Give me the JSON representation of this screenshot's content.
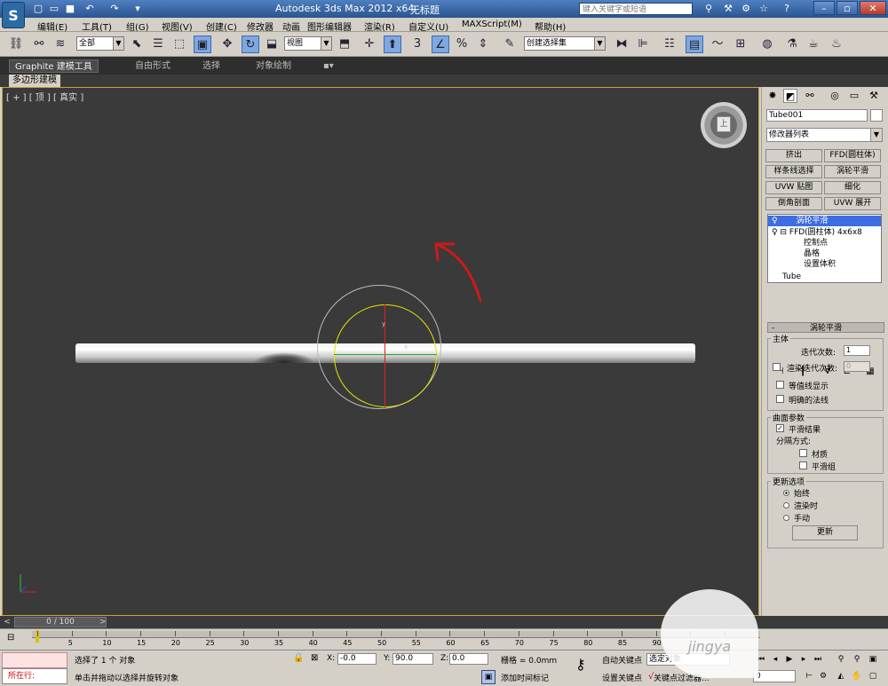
{
  "title_bar": {
    "title": "Autodesk 3ds Max  2012 x64",
    "file_name": "无标题",
    "search_placeholder": "键入关键字或短语",
    "app_icon": "3ds-max-logo",
    "quick_access_icons": [
      "new-icon",
      "open-icon",
      "save-icon",
      "undo-icon",
      "redo-icon"
    ],
    "help_icon": "help-icon"
  },
  "menu": [
    "编辑(E)",
    "工具(T)",
    "组(G)",
    "视图(V)",
    "创建(C)",
    "修改器",
    "动画",
    "图形编辑器",
    "渲染(R)",
    "自定义(U)",
    "MAXScript(M)",
    "帮助(H)"
  ],
  "toolbar": {
    "filter_value": "全部",
    "reference_value": "视图",
    "selection_set_value": "创建选择集",
    "snap_label": "3"
  },
  "ribbon": {
    "tabs": [
      "Graphite 建模工具",
      "自由形式",
      "选择",
      "对象绘制"
    ],
    "active_tab": "Graphite 建模工具",
    "sub_tab": "多边形建模"
  },
  "viewport": {
    "label": "[ + ] [ 顶 ] [ 真实 ]",
    "viewcube_face": "上",
    "gizmo_y": "y",
    "gizmo_x": "x",
    "border_color": "#c8a23a",
    "annotation_color": "#d01818"
  },
  "command_panel": {
    "object_name": "Tube001",
    "modifier_list": "修改器列表",
    "modifier_buttons": [
      "挤出",
      "FFD(圆柱体)",
      "样条线选择",
      "涡轮平滑",
      "UVW 贴图",
      "细化",
      "倒角剖面",
      "UVW 展开"
    ],
    "stack": [
      {
        "label": "涡轮平滑",
        "selected": true
      },
      {
        "label": "FFD(圆柱体) 4x6x8",
        "selected": false
      },
      {
        "label": "控制点",
        "selected": false
      },
      {
        "label": "晶格",
        "selected": false
      },
      {
        "label": "设置体积",
        "selected": false
      },
      {
        "label": "Tube",
        "selected": false
      }
    ],
    "rollout_title": "涡轮平滑",
    "main_group": "主体",
    "iterations_label": "迭代次数:",
    "iterations_value": "1",
    "render_iters_label": "渲染迭代次数:",
    "render_iters_value": "0",
    "isoline_label": "等值线显示",
    "explicit_normals_label": "明确的法线",
    "surface_group": "曲面参数",
    "smooth_result_label": "平滑结果",
    "separate_by_label": "分隔方式:",
    "materials_label": "材质",
    "smoothing_groups_label": "平滑组",
    "update_group": "更新选项",
    "always_label": "始终",
    "when_rendering_label": "渲染时",
    "manually_label": "手动",
    "update_button": "更新"
  },
  "timeline": {
    "position": "0 / 100",
    "ticks": [
      "0",
      "5",
      "10",
      "15",
      "20",
      "25",
      "30",
      "35",
      "40",
      "45",
      "50",
      "55",
      "60",
      "65",
      "70",
      "75",
      "80",
      "85",
      "90",
      "95",
      "100"
    ]
  },
  "status": {
    "running_label": "所在行:",
    "message1": "选择了 1 个 对象",
    "message2": "单击并拖动以选择并旋转对象",
    "x_label": "X:",
    "x_value": "-0.0",
    "y_label": "Y:",
    "y_value": "90.0",
    "z_label": "Z:",
    "z_value": "0.0",
    "grid_text": "栅格 = 0.0mm",
    "add_time_tag": "添加时间标记",
    "auto_key": "自动关键点",
    "set_key": "设置关键点",
    "selected_dropdown": "选定对象",
    "key_filters": "关键点过滤器...",
    "frame_value": "0"
  },
  "watermark": "jingya"
}
